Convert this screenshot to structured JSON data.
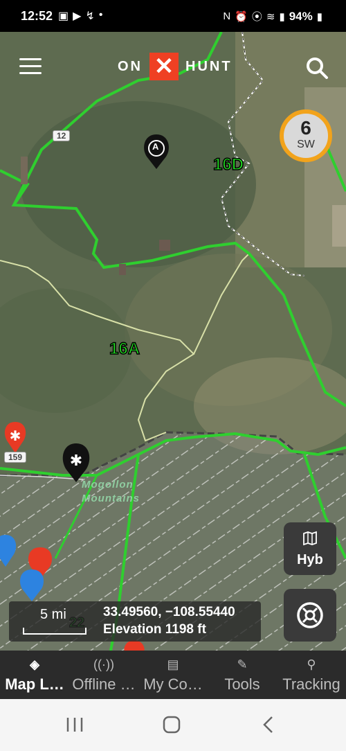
{
  "status_bar": {
    "time": "12:52",
    "battery": "94%",
    "left_icons": [
      "image-icon",
      "youtube-icon",
      "missed-call-icon",
      "dot-icon"
    ],
    "right_icons": [
      "nfc-icon",
      "alarm-icon",
      "location-icon",
      "wifi-icon",
      "signal-icon",
      "battery-icon"
    ]
  },
  "header": {
    "logo_left": "ON",
    "logo_mark": "✕",
    "logo_right": "HUNT",
    "brand_color": "#ef4023"
  },
  "wind": {
    "speed": "6",
    "direction": "SW",
    "ring_color": "#f2a31b"
  },
  "map": {
    "unit_labels": [
      "16D",
      "16A"
    ],
    "road_shields": [
      "12",
      "159"
    ],
    "feature_label_line1": "Mogollon",
    "feature_label_line2": "Mountains",
    "partial_label": "22",
    "boundary_color": "#2fcf2f",
    "pin_label_waypoint": "A"
  },
  "layer_button": {
    "label": "Hyb",
    "icon": "map-icon"
  },
  "info": {
    "scale_label": "5 mi",
    "coords": "33.49560, −108.55440",
    "elevation": "Elevation 1198 ft"
  },
  "bottom_nav": [
    {
      "label": "Map L…",
      "icon": "map-layers-icon",
      "active": true
    },
    {
      "label": "Offline …",
      "icon": "offline-icon",
      "active": false
    },
    {
      "label": "My Co…",
      "icon": "my-content-icon",
      "active": false
    },
    {
      "label": "Tools",
      "icon": "tools-icon",
      "active": false
    },
    {
      "label": "Tracking",
      "icon": "tracking-icon",
      "active": false
    }
  ]
}
